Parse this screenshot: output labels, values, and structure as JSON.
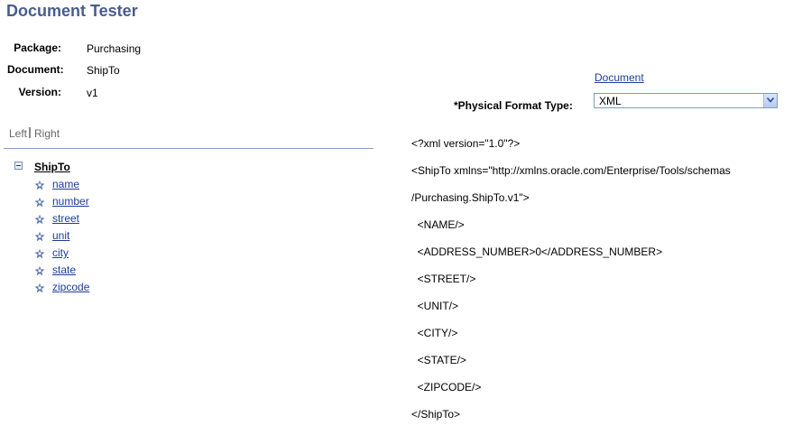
{
  "page": {
    "title": "Document Tester"
  },
  "fields": {
    "package_label": "Package:",
    "package_value": "Purchasing",
    "document_label": "Document:",
    "document_value": "ShipTo",
    "version_label": "Version:",
    "version_value": "v1"
  },
  "document_link": "Document",
  "format": {
    "label": "*Physical Format Type:",
    "value": "XML"
  },
  "tabs": {
    "left": "Left",
    "right": "Right"
  },
  "tree": {
    "root": "ShipTo",
    "children": [
      "name",
      "number",
      "street",
      "unit",
      "city",
      "state",
      "zipcode"
    ]
  },
  "xml_lines": [
    "<?xml version=\"1.0\"?>",
    "<ShipTo xmlns=\"http://xmlns.oracle.com/Enterprise/Tools/schemas",
    "/Purchasing.ShipTo.v1\">",
    "  <NAME/>",
    "  <ADDRESS_NUMBER>0</ADDRESS_NUMBER>",
    "  <STREET/>",
    "  <UNIT/>",
    "  <CITY/>",
    "  <STATE/>",
    "  <ZIPCODE/>",
    "</ShipTo>"
  ]
}
